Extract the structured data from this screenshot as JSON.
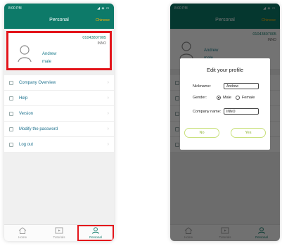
{
  "status_bar": {
    "time": "8:00 PM",
    "system": "◢ ◈ ▭"
  },
  "header": {
    "title": "Personal",
    "language": "Chinese"
  },
  "profile": {
    "phone": "01043807005",
    "company": "INNO",
    "name": "Andrew",
    "gender": "male"
  },
  "menu": [
    {
      "label": "Company Overview"
    },
    {
      "label": "Help"
    },
    {
      "label": "Version"
    },
    {
      "label": "Modify the password"
    },
    {
      "label": "Log out"
    }
  ],
  "tabs": [
    {
      "label": "Home"
    },
    {
      "label": "Tutorials"
    },
    {
      "label": "Personal"
    }
  ],
  "dialog": {
    "title": "Edit your profile",
    "nickname_label": "Nickname:",
    "nickname_value": "Andrew",
    "gender_label": "Gender:",
    "male": "Male",
    "female": "Female",
    "company_label": "Company name:",
    "company_value": "INNO",
    "no": "No",
    "yes": "Yes"
  },
  "colors": {
    "accent": "#0d7a69",
    "highlight": "#e3151b",
    "language": "#ffb300",
    "dialog_button": "#8bb02f"
  }
}
